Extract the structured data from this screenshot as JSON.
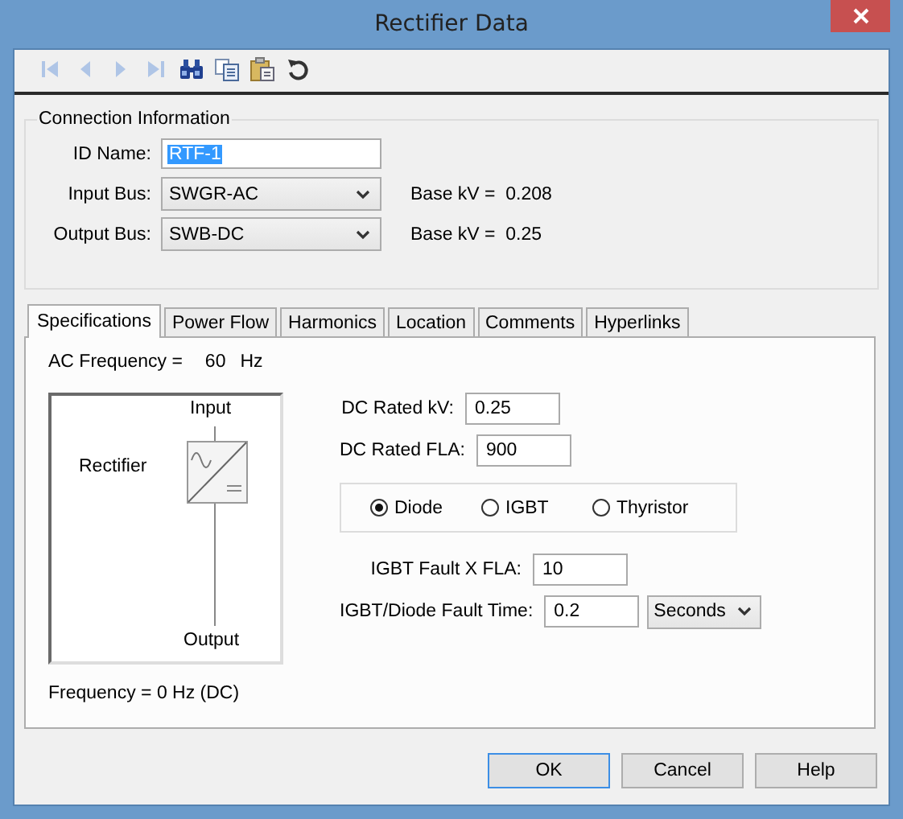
{
  "window": {
    "title": "Rectifier Data"
  },
  "toolbar": [
    {
      "kind": "first",
      "disabled": true
    },
    {
      "kind": "previous",
      "disabled": true
    },
    {
      "kind": "next",
      "disabled": true
    },
    {
      "kind": "last",
      "disabled": true
    },
    {
      "kind": "find",
      "disabled": false
    },
    {
      "kind": "copy",
      "disabled": false
    },
    {
      "kind": "paste",
      "disabled": false
    },
    {
      "kind": "undo",
      "disabled": false
    }
  ],
  "connection": {
    "title": "Connection Information",
    "id_label": "ID Name:",
    "id_value": "RTF-1",
    "id_value_selected": true,
    "buses": [
      {
        "label": "Input Bus:",
        "value": "SWGR-AC",
        "base_label": "Base kV =",
        "base_value": "0.208"
      },
      {
        "label": "Output Bus:",
        "value": "SWB-DC",
        "base_label": "Base kV =",
        "base_value": "0.25"
      }
    ]
  },
  "tabs": [
    {
      "label": "Specifications",
      "selected": true
    },
    {
      "label": "Power Flow",
      "selected": false
    },
    {
      "label": "Harmonics",
      "selected": false
    },
    {
      "label": "Location",
      "selected": false
    },
    {
      "label": "Comments",
      "selected": false
    },
    {
      "label": "Hyperlinks",
      "selected": false
    }
  ],
  "specifications": {
    "ac_frequency": {
      "label": "AC Frequency =",
      "value": "60",
      "unit": "Hz"
    },
    "diagram": {
      "input": "Input",
      "name": "Rectifier",
      "output": "Output"
    },
    "ratings": [
      {
        "label": "DC Rated kV:",
        "value": "0.25"
      },
      {
        "label": "DC Rated FLA:",
        "value": "900"
      }
    ],
    "types": [
      {
        "label": "Diode",
        "selected": true
      },
      {
        "label": "IGBT",
        "selected": false
      },
      {
        "label": "Thyristor",
        "selected": false
      }
    ],
    "fault": [
      {
        "label": "IGBT Fault X FLA:",
        "value": "10"
      },
      {
        "label": "IGBT/Diode Fault Time:",
        "value": "0.2",
        "unit": "Seconds"
      }
    ],
    "frequency_note": "Frequency = 0 Hz (DC)"
  },
  "buttons": [
    {
      "label": "OK",
      "default": true
    },
    {
      "label": "Cancel",
      "default": false
    },
    {
      "label": "Help",
      "default": false
    }
  ]
}
